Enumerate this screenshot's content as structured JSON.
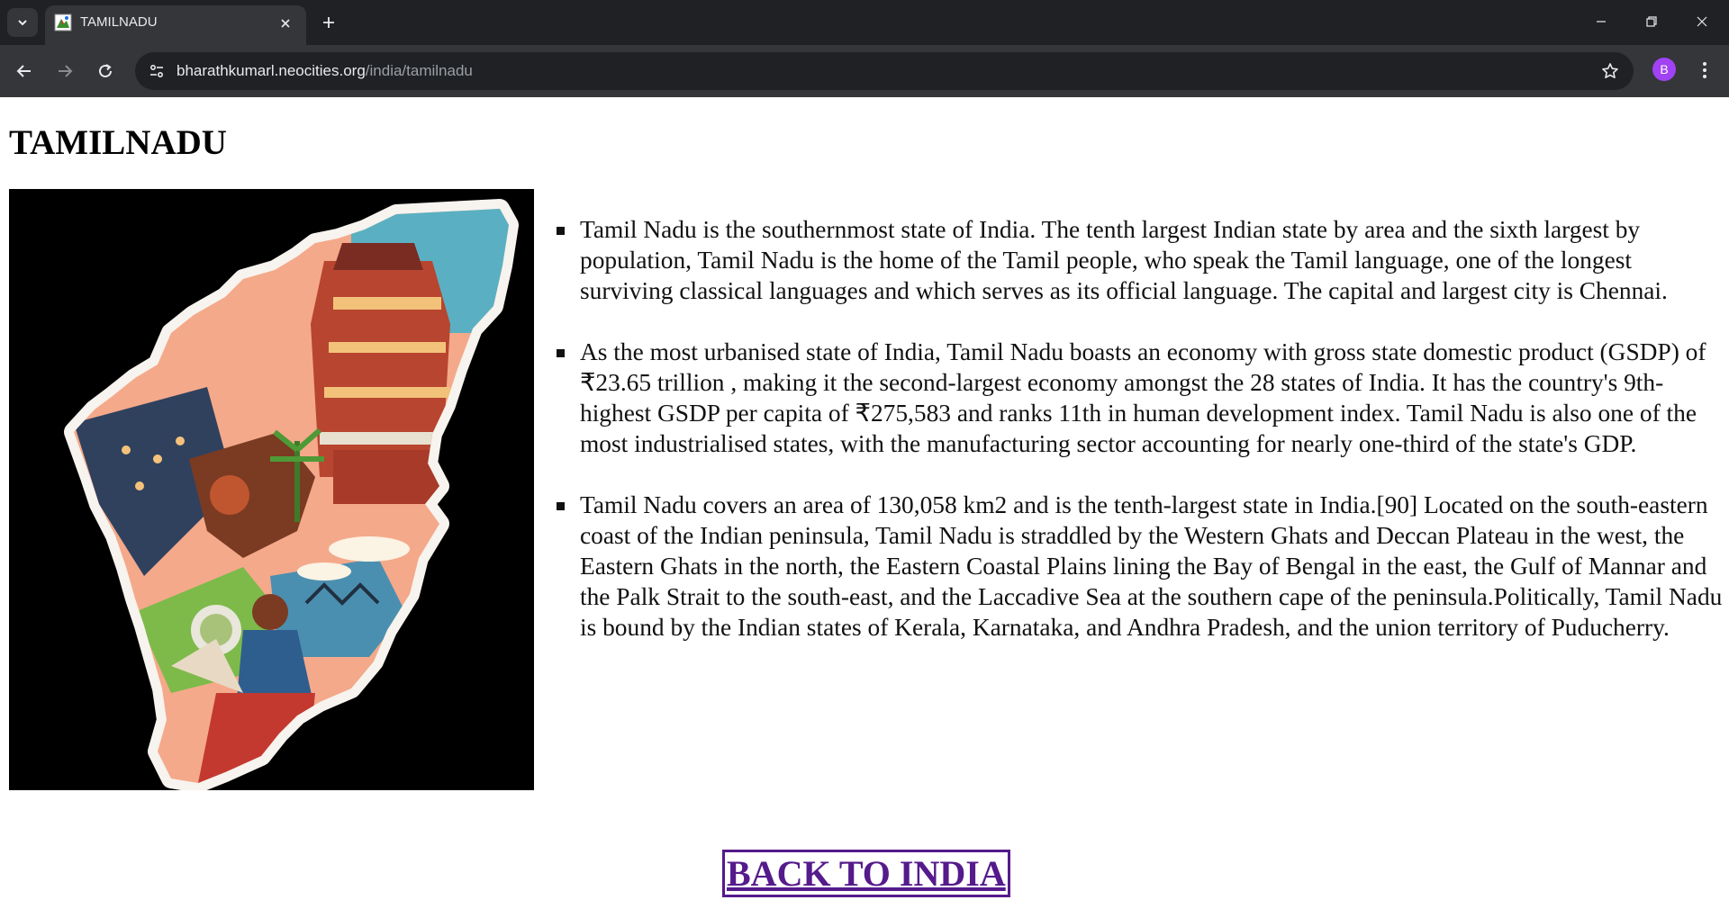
{
  "browser": {
    "tab_title": "TAMILNADU",
    "url_domain": "bharathkumarl.neocities.org",
    "url_path": "/india/tamilnadu",
    "profile_initial": "B"
  },
  "page": {
    "title": "TAMILNADU",
    "facts": [
      "Tamil Nadu is the southernmost state of India. The tenth largest Indian state by area and the sixth largest by population, Tamil Nadu is the home of the Tamil people, who speak the Tamil language, one of the longest surviving classical languages and which serves as its official language. The capital and largest city is Chennai.",
      "As the most urbanised state of India, Tamil Nadu boasts an economy with gross state domestic product (GSDP) of ₹23.65 trillion , making it the second-largest economy amongst the 28 states of India. It has the country's 9th-highest GSDP per capita of ₹275,583 and ranks 11th in human development index. Tamil Nadu is also one of the most industrialised states, with the manufacturing sector accounting for nearly one-third of the state's GDP.",
      "Tamil Nadu covers an area of 130,058 km2 and is the tenth-largest state in India.[90] Located on the south-eastern coast of the Indian peninsula, Tamil Nadu is straddled by the Western Ghats and Deccan Plateau in the west, the Eastern Ghats in the north, the Eastern Coastal Plains lining the Bay of Bengal in the east, the Gulf of Mannar and the Palk Strait to the south-east, and the Laccadive Sea at the southern cape of the peninsula.Politically, Tamil Nadu is bound by the Indian states of Kerala, Karnataka, and Andhra Pradesh, and the union territory of Puducherry."
    ],
    "back_link_label": "BACK TO INDIA"
  },
  "colors": {
    "link": "#551a8b",
    "chrome_dark": "#202124",
    "chrome_mid": "#35363a",
    "avatar": "#a142f4"
  }
}
